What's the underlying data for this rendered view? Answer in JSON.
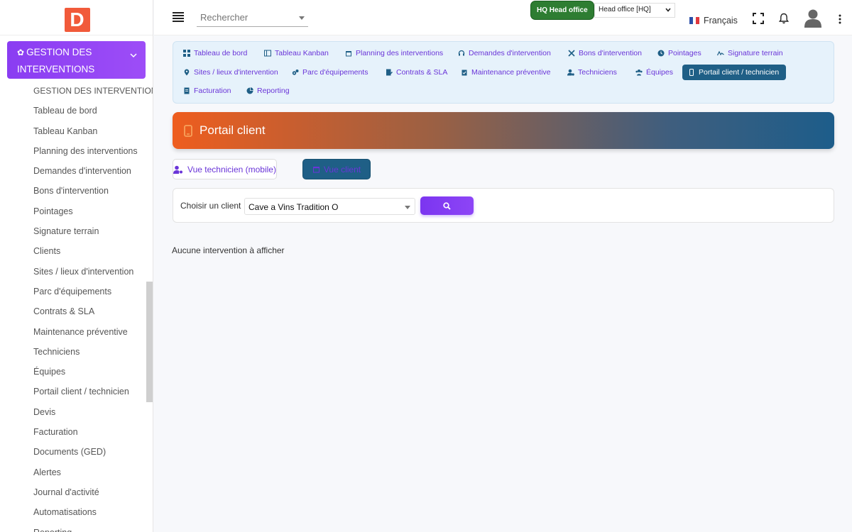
{
  "logo": {
    "letter": "D"
  },
  "sidebar": {
    "module_title": "GESTION DES INTERVENTIONS",
    "items": [
      {
        "label": "GESTION DES INTERVENTIONS"
      },
      {
        "label": "Tableau de bord"
      },
      {
        "label": "Tableau Kanban"
      },
      {
        "label": "Planning des interventions"
      },
      {
        "label": "Demandes d'intervention"
      },
      {
        "label": "Bons d'intervention"
      },
      {
        "label": "Pointages"
      },
      {
        "label": "Signature terrain"
      },
      {
        "label": "Clients"
      },
      {
        "label": "Sites / lieux d'intervention"
      },
      {
        "label": "Parc d'équipements"
      },
      {
        "label": "Contrats & SLA"
      },
      {
        "label": "Maintenance préventive"
      },
      {
        "label": "Techniciens"
      },
      {
        "label": "Équipes"
      },
      {
        "label": "Portail client / technicien"
      },
      {
        "label": "Devis"
      },
      {
        "label": "Facturation"
      },
      {
        "label": "Documents (GED)"
      },
      {
        "label": "Alertes"
      },
      {
        "label": "Journal d'activité"
      },
      {
        "label": "Automatisations"
      },
      {
        "label": "Reporting"
      }
    ]
  },
  "topbar": {
    "search_placeholder": "Rechercher",
    "hq_badge": "HQ Head office",
    "office_select": "Head office [HQ]",
    "language": "Français"
  },
  "tabs": [
    {
      "label": "Tableau de bord",
      "icon": "grid-icon"
    },
    {
      "label": "Tableau Kanban",
      "icon": "kanban-icon"
    },
    {
      "label": "Planning des interventions",
      "icon": "calendar-icon"
    },
    {
      "label": "Demandes d'intervention",
      "icon": "headset-icon"
    },
    {
      "label": "Bons d'intervention",
      "icon": "tools-icon"
    },
    {
      "label": "Pointages",
      "icon": "clock-icon"
    },
    {
      "label": "Signature terrain",
      "icon": "signature-icon"
    },
    {
      "label": "Sites / lieux d'intervention",
      "icon": "map-pin-icon"
    },
    {
      "label": "Parc d'équipements",
      "icon": "cogs-icon"
    },
    {
      "label": "Contrats & SLA",
      "icon": "contract-icon"
    },
    {
      "label": "Maintenance préventive",
      "icon": "clipboard-check-icon"
    },
    {
      "label": "Techniciens",
      "icon": "user-cog-icon"
    },
    {
      "label": "Équipes",
      "icon": "users-icon"
    },
    {
      "label": "Portail client / technicien",
      "icon": "mobile-icon",
      "active": true
    },
    {
      "label": "Facturation",
      "icon": "invoice-icon"
    },
    {
      "label": "Reporting",
      "icon": "chart-pie-icon"
    }
  ],
  "banner": {
    "title": "Portail client"
  },
  "views": {
    "technician": "Vue technicien (mobile)",
    "client": "Vue client"
  },
  "filter": {
    "label": "Choisir un client",
    "selected_client": "Cave a Vins Tradition O"
  },
  "empty_message": "Aucune intervention à afficher",
  "colors": {
    "accent_purple": "#7b35f0",
    "active_tab": "#1f5f86",
    "logo": "#f15a3a",
    "hq_badge": "#2e7d32"
  }
}
